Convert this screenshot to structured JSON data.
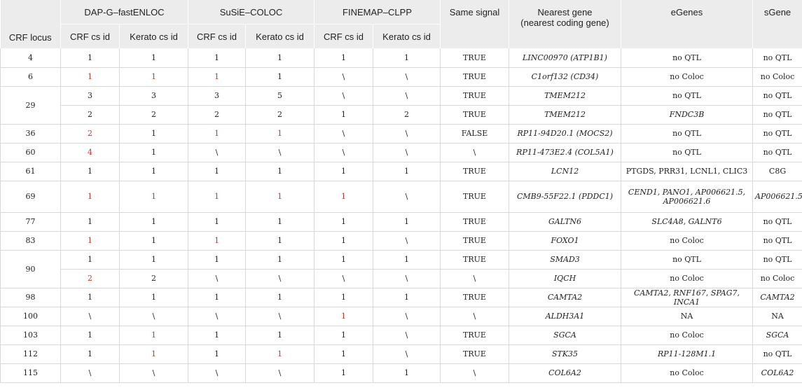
{
  "headers": {
    "crf_locus": "CRF locus",
    "group1": "DAP-G–fastENLOC",
    "group2": "SuSiE–COLOC",
    "group3": "FINEMAP–CLPP",
    "same_signal": "Same signal",
    "nearest_gene_line1": "Nearest gene",
    "nearest_gene_line2": "(nearest coding gene)",
    "egenes": "eGenes",
    "sgene": "sGene",
    "crf_cs_id": "CRF cs id",
    "kerato_cs_id": "Kerato cs id"
  },
  "colors": {
    "highlight": "#c0392b",
    "header_bg": "#ececec",
    "border": "#d8d8d8"
  },
  "rows": [
    {
      "locus": "4",
      "locus_rowspan": 1,
      "v": [
        "1",
        "1",
        "1",
        "1",
        "1",
        "1"
      ],
      "red": [],
      "same": "TRUE",
      "gene": "LINC00970 (ATP1B1)",
      "gene_italic": true,
      "egenes": "no QTL",
      "egenes_italic": false,
      "sgene": "no QTL",
      "sgene_italic": false
    },
    {
      "locus": "6",
      "locus_rowspan": 1,
      "v": [
        "1",
        "1",
        "1",
        "1",
        "\\",
        "\\"
      ],
      "red": [
        0,
        1,
        2
      ],
      "same": "TRUE",
      "gene": "C1orf132 (CD34)",
      "gene_italic": true,
      "egenes": "no Coloc",
      "egenes_italic": false,
      "sgene": "no Coloc",
      "sgene_italic": false
    },
    {
      "locus": "29",
      "locus_rowspan": 2,
      "v": [
        "3",
        "3",
        "3",
        "5",
        "\\",
        "\\"
      ],
      "red": [],
      "same": "TRUE",
      "gene": "TMEM212",
      "gene_italic": true,
      "egenes": "no QTL",
      "egenes_italic": false,
      "sgene": "no QTL",
      "sgene_italic": false
    },
    {
      "locus": null,
      "v": [
        "2",
        "2",
        "2",
        "2",
        "1",
        "2"
      ],
      "red": [],
      "same": "TRUE",
      "gene": "TMEM212",
      "gene_italic": true,
      "egenes": "FNDC3B",
      "egenes_italic": true,
      "sgene": "no QTL",
      "sgene_italic": false
    },
    {
      "locus": "36",
      "locus_rowspan": 1,
      "v": [
        "2",
        "1",
        "1",
        "1",
        "\\",
        "\\"
      ],
      "red": [
        0,
        2,
        3
      ],
      "same": "FALSE",
      "gene": "RP11-94D20.1 (MOCS2)",
      "gene_italic": true,
      "egenes": "no QTL",
      "egenes_italic": false,
      "sgene": "no QTL",
      "sgene_italic": false
    },
    {
      "locus": "60",
      "locus_rowspan": 1,
      "v": [
        "4",
        "1",
        "\\",
        "\\",
        "\\",
        "\\"
      ],
      "red": [
        0
      ],
      "same": "\\",
      "gene": "RP11-473E2.4 (COL5A1)",
      "gene_italic": true,
      "egenes": "no QTL",
      "egenes_italic": false,
      "sgene": "no QTL",
      "sgene_italic": false
    },
    {
      "locus": "61",
      "locus_rowspan": 1,
      "v": [
        "1",
        "1",
        "1",
        "1",
        "1",
        "1"
      ],
      "red": [],
      "same": "TRUE",
      "gene": "LCN12",
      "gene_italic": true,
      "egenes": "PTGDS, PRR31, LCNL1, CLIC3",
      "egenes_italic": false,
      "sgene": "C8G",
      "sgene_italic": false
    },
    {
      "locus": "69",
      "locus_rowspan": 1,
      "tall": true,
      "v": [
        "1",
        "1",
        "1",
        "1",
        "1",
        "\\"
      ],
      "red": [
        0,
        1,
        2,
        3,
        4
      ],
      "same": "TRUE",
      "gene": "CMB9-55F22.1 (PDDC1)",
      "gene_italic": true,
      "egenes": "CEND1, PANO1, AP006621.5, AP006621.6",
      "egenes_italic": true,
      "sgene": "AP006621.5",
      "sgene_italic": true
    },
    {
      "locus": "77",
      "locus_rowspan": 1,
      "v": [
        "1",
        "1",
        "1",
        "1",
        "1",
        "1"
      ],
      "red": [],
      "same": "TRUE",
      "gene": "GALTN6",
      "gene_italic": true,
      "egenes": "SLC4A8, GALNT6",
      "egenes_italic": true,
      "sgene": "no QTL",
      "sgene_italic": false
    },
    {
      "locus": "83",
      "locus_rowspan": 1,
      "v": [
        "1",
        "1",
        "1",
        "1",
        "1",
        "\\"
      ],
      "red": [
        0,
        2
      ],
      "same": "TRUE",
      "gene": "FOXO1",
      "gene_italic": true,
      "egenes": "no Coloc",
      "egenes_italic": false,
      "sgene": "no QTL",
      "sgene_italic": false
    },
    {
      "locus": "90",
      "locus_rowspan": 2,
      "v": [
        "1",
        "1",
        "1",
        "1",
        "1",
        "1"
      ],
      "red": [],
      "same": "TRUE",
      "gene": "SMAD3",
      "gene_italic": true,
      "egenes": "no QTL",
      "egenes_italic": false,
      "sgene": "no QTL",
      "sgene_italic": false
    },
    {
      "locus": null,
      "v": [
        "2",
        "2",
        "\\",
        "\\",
        "\\",
        "\\"
      ],
      "red": [
        0
      ],
      "same": "\\",
      "gene": "IQCH",
      "gene_italic": true,
      "egenes": "no Coloc",
      "egenes_italic": false,
      "sgene": "no Coloc",
      "sgene_italic": false
    },
    {
      "locus": "98",
      "locus_rowspan": 1,
      "v": [
        "1",
        "1",
        "1",
        "1",
        "1",
        "1"
      ],
      "red": [],
      "same": "TRUE",
      "gene": "CAMTA2",
      "gene_italic": true,
      "egenes": "CAMTA2, RNF167, SPAG7, INCA1",
      "egenes_italic": true,
      "sgene": "CAMTA2",
      "sgene_italic": true
    },
    {
      "locus": "100",
      "locus_rowspan": 1,
      "v": [
        "\\",
        "\\",
        "\\",
        "\\",
        "1",
        "\\"
      ],
      "red": [
        4
      ],
      "same": "\\",
      "gene": "ALDH3A1",
      "gene_italic": true,
      "egenes": "NA",
      "egenes_italic": false,
      "sgene": "NA",
      "sgene_italic": false
    },
    {
      "locus": "103",
      "locus_rowspan": 1,
      "v": [
        "1",
        "1",
        "1",
        "1",
        "1",
        "\\"
      ],
      "red": [
        1
      ],
      "same": "TRUE",
      "gene": "SGCA",
      "gene_italic": true,
      "egenes": "no Coloc",
      "egenes_italic": false,
      "sgene": "SGCA",
      "sgene_italic": true
    },
    {
      "locus": "112",
      "locus_rowspan": 1,
      "v": [
        "1",
        "1",
        "1",
        "1",
        "1",
        "\\"
      ],
      "red": [
        1,
        3
      ],
      "same": "TRUE",
      "gene": "STK35",
      "gene_italic": true,
      "egenes": "RP11-128M1.1",
      "egenes_italic": true,
      "sgene": "no QTL",
      "sgene_italic": false
    },
    {
      "locus": "115",
      "locus_rowspan": 1,
      "v": [
        "\\",
        "\\",
        "\\",
        "\\",
        "1",
        "1"
      ],
      "red": [],
      "same": "\\",
      "gene": "COL6A2",
      "gene_italic": true,
      "egenes": "no Coloc",
      "egenes_italic": false,
      "sgene": "COL6A2",
      "sgene_italic": true
    }
  ]
}
